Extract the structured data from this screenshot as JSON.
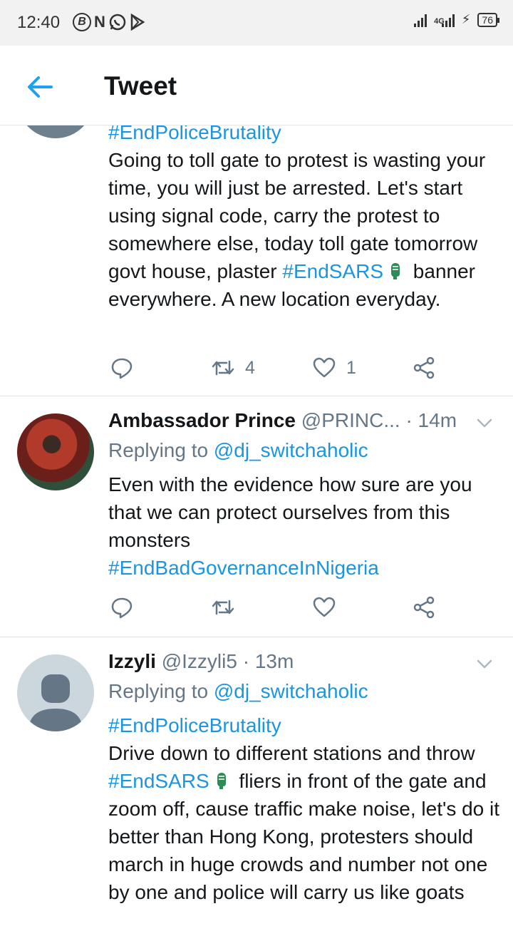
{
  "status_bar": {
    "time": "12:40",
    "app_icons": [
      "B",
      "N",
      "whatsapp",
      "play"
    ],
    "network": "4G",
    "battery": "76"
  },
  "header": {
    "title": "Tweet"
  },
  "tweets": [
    {
      "hashtag_top": "#EndPoliceBrutality",
      "text_1": "Going to toll gate to protest is wasting your time,  you will just be arrested.  Let's start using signal code, carry the protest to somewhere else,  today toll gate tomorrow govt house, plaster ",
      "hashtag_inline": "#EndSARS",
      "text_2": " banner everywhere. A new location everyday.",
      "retweets": "4",
      "likes": "1"
    },
    {
      "name": "Ambassador Prince",
      "handle": "@PRINC...",
      "time": " · 14m",
      "replying_label": "Replying to ",
      "replying_to": "@dj_switchaholic",
      "text": "Even with the evidence how sure are you that we can protect ourselves from this monsters",
      "hashtag": "#EndBadGovernanceInNigeria"
    },
    {
      "name": "Izzyli",
      "handle": "@Izzyli5",
      "time": " · 13m",
      "replying_label": "Replying to ",
      "replying_to": "@dj_switchaholic",
      "hashtag_top": "#EndPoliceBrutality",
      "text_1": "Drive down to different stations and throw ",
      "hashtag_inline": "#EndSARS",
      "text_2": " fliers in front of the gate and zoom off,  cause traffic make noise,  let's do it better than Hong Kong, protesters should march in huge crowds and number not one by one and police will carry us like goats"
    }
  ],
  "icons": {
    "back": "arrow-left-icon",
    "reply": "reply-icon",
    "retweet": "retweet-icon",
    "like": "heart-icon",
    "share": "share-icon",
    "menu": "chevron-down-icon"
  },
  "colors": {
    "accent": "#1da1f2",
    "link": "#1b95e0",
    "muted": "#657786",
    "divider": "#e1e8ed",
    "status_bar": "#f2f2f2"
  }
}
